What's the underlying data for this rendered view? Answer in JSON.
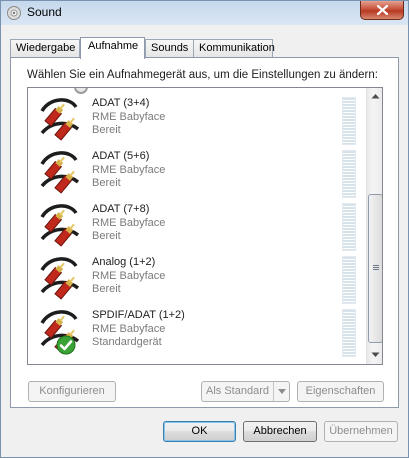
{
  "window": {
    "title": "Sound"
  },
  "tabs": [
    {
      "label": "Wiedergabe",
      "active": false
    },
    {
      "label": "Aufnahme",
      "active": true
    },
    {
      "label": "Sounds",
      "active": false
    },
    {
      "label": "Kommunikation",
      "active": false
    }
  ],
  "instruction": "Wählen Sie ein Aufnahmegerät aus, um die Einstellungen zu ändern:",
  "devices": [
    {
      "name": "ADAT (3+4)",
      "driver": "RME Babyface",
      "status": "Bereit",
      "default": false
    },
    {
      "name": "ADAT (5+6)",
      "driver": "RME Babyface",
      "status": "Bereit",
      "default": false
    },
    {
      "name": "ADAT (7+8)",
      "driver": "RME Babyface",
      "status": "Bereit",
      "default": false
    },
    {
      "name": "Analog (1+2)",
      "driver": "RME Babyface",
      "status": "Bereit",
      "default": false
    },
    {
      "name": "SPDIF/ADAT (1+2)",
      "driver": "RME Babyface",
      "status": "Standardgerät",
      "default": true
    }
  ],
  "buttons": {
    "configure": "Konfigurieren",
    "set_default": "Als Standard",
    "properties": "Eigenschaften",
    "ok": "OK",
    "cancel": "Abbrechen",
    "apply": "Übernehmen"
  },
  "icons": {
    "app": "speaker-icon",
    "device": "rca-cable-icon",
    "default_badge": "green-checkmark-icon"
  },
  "colors": {
    "plug_red": "#c0281b",
    "plug_gold": "#d6b14a",
    "check_green": "#3aa335"
  }
}
